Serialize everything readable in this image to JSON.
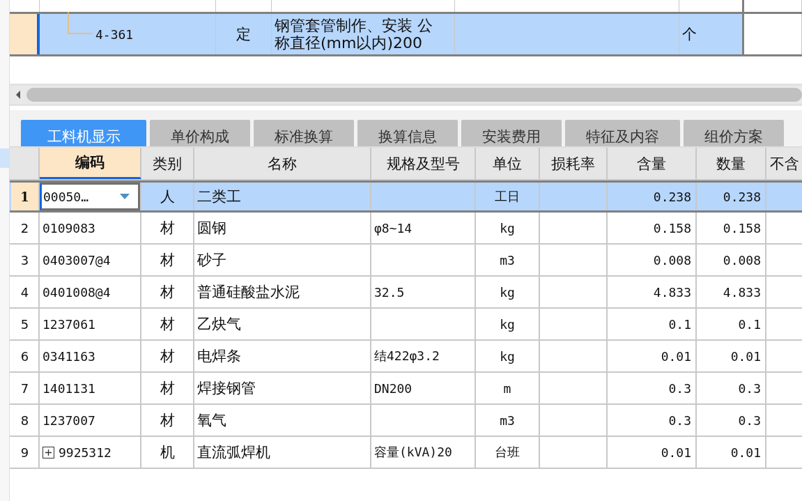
{
  "upper_grid": {
    "rows": [
      {
        "code": "4-361",
        "type": "定",
        "name": "钢管套管制作、安装 公称直径(mm以内)200",
        "unit": "个",
        "selected": true
      }
    ]
  },
  "tabs": [
    {
      "label": "工料机显示",
      "selected": true
    },
    {
      "label": "单价构成",
      "selected": false
    },
    {
      "label": "标准换算",
      "selected": false
    },
    {
      "label": "换算信息",
      "selected": false
    },
    {
      "label": "安装费用",
      "selected": false
    },
    {
      "label": "特征及内容",
      "selected": false
    },
    {
      "label": "组价方案",
      "selected": false
    }
  ],
  "table": {
    "columns": [
      "编码",
      "类别",
      "名称",
      "规格及型号",
      "单位",
      "损耗率",
      "含量",
      "数量",
      "不含"
    ],
    "rows": [
      {
        "no": "1",
        "code": "00050…",
        "type": "人",
        "name": "二类工",
        "spec": "",
        "unit": "工日",
        "loss": "",
        "content": "0.238",
        "qty": "0.238",
        "selected": true,
        "editing": true,
        "expandable": false
      },
      {
        "no": "2",
        "code": "0109083",
        "type": "材",
        "name": "圆钢",
        "spec": "φ8~14",
        "unit": "kg",
        "loss": "",
        "content": "0.158",
        "qty": "0.158",
        "selected": false,
        "editing": false,
        "expandable": false
      },
      {
        "no": "3",
        "code": "0403007@4",
        "type": "材",
        "name": "砂子",
        "spec": "",
        "unit": "m3",
        "loss": "",
        "content": "0.008",
        "qty": "0.008",
        "selected": false,
        "editing": false,
        "expandable": false
      },
      {
        "no": "4",
        "code": "0401008@4",
        "type": "材",
        "name": "普通硅酸盐水泥",
        "spec": "32.5",
        "unit": "kg",
        "loss": "",
        "content": "4.833",
        "qty": "4.833",
        "selected": false,
        "editing": false,
        "expandable": false
      },
      {
        "no": "5",
        "code": "1237061",
        "type": "材",
        "name": "乙炔气",
        "spec": "",
        "unit": "kg",
        "loss": "",
        "content": "0.1",
        "qty": "0.1",
        "selected": false,
        "editing": false,
        "expandable": false
      },
      {
        "no": "6",
        "code": "0341163",
        "type": "材",
        "name": "电焊条",
        "spec": "结422φ3.2",
        "unit": "kg",
        "loss": "",
        "content": "0.01",
        "qty": "0.01",
        "selected": false,
        "editing": false,
        "expandable": false
      },
      {
        "no": "7",
        "code": "1401131",
        "type": "材",
        "name": "焊接钢管",
        "spec": "DN200",
        "unit": "m",
        "loss": "",
        "content": "0.3",
        "qty": "0.3",
        "selected": false,
        "editing": false,
        "expandable": false
      },
      {
        "no": "8",
        "code": "1237007",
        "type": "材",
        "name": "氧气",
        "spec": "",
        "unit": "m3",
        "loss": "",
        "content": "0.3",
        "qty": "0.3",
        "selected": false,
        "editing": false,
        "expandable": false
      },
      {
        "no": "9",
        "code": "9925312",
        "type": "机",
        "name": "直流弧焊机",
        "spec": "容量(kVA)20",
        "unit": "台班",
        "loss": "",
        "content": "0.01",
        "qty": "0.01",
        "selected": false,
        "editing": false,
        "expandable": true
      }
    ]
  }
}
